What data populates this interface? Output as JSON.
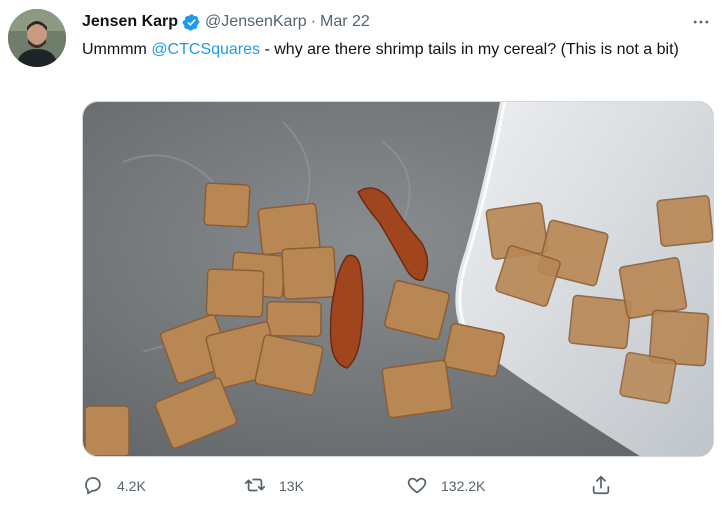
{
  "tweet": {
    "author_name": "Jensen Karp",
    "handle": "@JensenKarp",
    "separator": "·",
    "date": "Mar 22",
    "text_before": "Ummmm ",
    "mention": "@CTCSquares",
    "text_after": " - why are there shrimp tails in my cereal? (This is not a bit)",
    "verified": true,
    "accent_color": "#1d9bf0"
  },
  "actions": {
    "reply_count": "4.2K",
    "retweet_count": "13K",
    "like_count": "132.2K"
  },
  "icons": {
    "more": "more-icon",
    "reply": "reply-icon",
    "retweet": "retweet-icon",
    "like": "like-icon",
    "share": "share-icon"
  }
}
